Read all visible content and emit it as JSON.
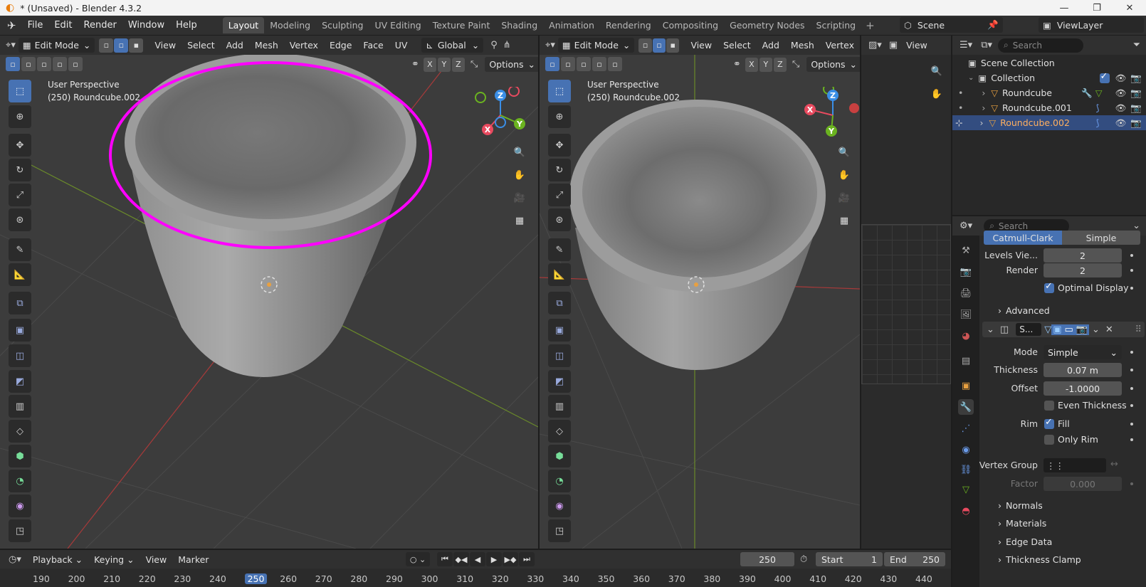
{
  "window": {
    "title": "* (Unsaved) - Blender 4.3.2",
    "min": "—",
    "max": "❐",
    "close": "✕"
  },
  "menu": [
    "File",
    "Edit",
    "Render",
    "Window",
    "Help"
  ],
  "workspaces": [
    "Layout",
    "Modeling",
    "Sculpting",
    "UV Editing",
    "Texture Paint",
    "Shading",
    "Animation",
    "Rendering",
    "Compositing",
    "Geometry Nodes",
    "Scripting"
  ],
  "scene": {
    "name": "Scene",
    "view_layer": "ViewLayer"
  },
  "viewport_left": {
    "mode": "Edit Mode",
    "menus": [
      "View",
      "Select",
      "Add",
      "Mesh",
      "Vertex",
      "Edge",
      "Face",
      "UV"
    ],
    "orientation": "Global",
    "options": "Options",
    "perspective": "User Perspective",
    "object": "(250) Roundcube.002"
  },
  "viewport_right": {
    "mode": "Edit Mode",
    "menus": [
      "View",
      "Select",
      "Add",
      "Mesh",
      "Vertex"
    ],
    "options": "Options",
    "perspective": "User Perspective",
    "object": "(250) Roundcube.002"
  },
  "axes": {
    "x": "X",
    "y": "Y",
    "z": "Z"
  },
  "image_editor": {
    "view": "View"
  },
  "outliner": {
    "search_placeholder": "Search",
    "rows": [
      {
        "name": "Scene Collection"
      },
      {
        "name": "Collection"
      },
      {
        "name": "Roundcube"
      },
      {
        "name": "Roundcube.001"
      },
      {
        "name": "Roundcube.002"
      }
    ]
  },
  "properties": {
    "search_placeholder": "Search",
    "subdiv": {
      "catmull": "Catmull-Clark",
      "simple": "Simple",
      "levels_label": "Levels Vie...",
      "levels_value": "2",
      "render_label": "Render",
      "render_value": "2",
      "optimal": "Optimal Display",
      "advanced": "Advanced"
    },
    "solidify": {
      "name": "S...",
      "mode_label": "Mode",
      "mode_value": "Simple",
      "thickness_label": "Thickness",
      "thickness_value": "0.07 m",
      "offset_label": "Offset",
      "offset_value": "-1.0000",
      "even": "Even Thickness",
      "rim_label": "Rim",
      "fill": "Fill",
      "only_rim": "Only Rim",
      "vgroup_label": "Vertex Group",
      "factor_label": "Factor",
      "factor_value": "0.000",
      "sections": [
        "Normals",
        "Materials",
        "Edge Data",
        "Thickness Clamp"
      ]
    }
  },
  "timeline": {
    "menus": [
      "Playback",
      "Keying",
      "View",
      "Marker"
    ],
    "frame": "250",
    "start_label": "Start",
    "start": "1",
    "end_label": "End",
    "end": "250",
    "ticks": [
      "190",
      "200",
      "210",
      "220",
      "230",
      "240",
      "250",
      "260",
      "270",
      "280",
      "290",
      "300",
      "310",
      "320",
      "330",
      "340",
      "350",
      "360",
      "370",
      "380",
      "390",
      "400",
      "410",
      "420",
      "430",
      "440"
    ],
    "current": "250"
  },
  "colors": {
    "accent": "#4772b3",
    "highlight_ring": "#ff00ff",
    "object_orange": "#e8a040",
    "axis_x": "#e84a5f",
    "axis_y": "#6bb320",
    "axis_z": "#3a8ee6"
  }
}
